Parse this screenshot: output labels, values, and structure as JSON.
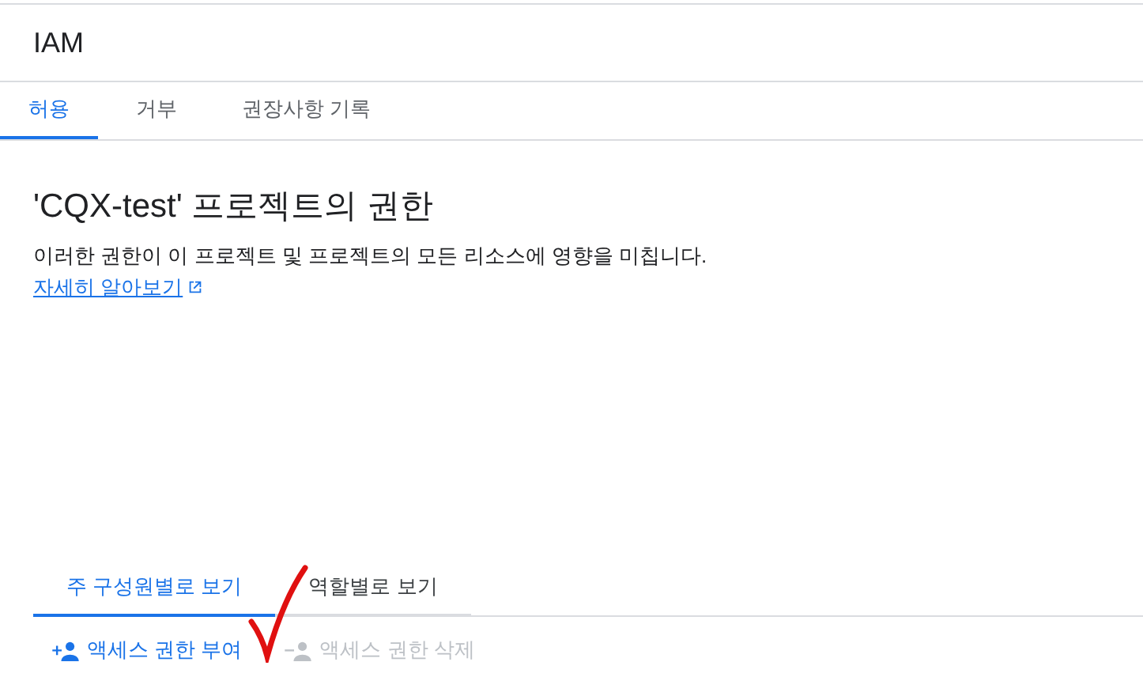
{
  "header": {
    "title": "IAM"
  },
  "tabs": [
    {
      "label": "허용",
      "selected": true
    },
    {
      "label": "거부",
      "selected": false
    },
    {
      "label": "권장사항 기록",
      "selected": false
    }
  ],
  "heading": "'CQX-test' 프로젝트의 권한",
  "description": {
    "text": "이러한 권한이 이 프로젝트 및 프로젝트의 모든 리소스에 영향을 미칩니다.",
    "link": "자세히 알아보기"
  },
  "view_tabs": [
    {
      "label": "주 구성원별로 보기",
      "selected": true
    },
    {
      "label": "역할별로 보기",
      "selected": false
    }
  ],
  "actions": [
    {
      "label": "액세스 권한 부여",
      "kind": "add",
      "disabled": false
    },
    {
      "label": "액세스 권한 삭제",
      "kind": "remove",
      "disabled": true
    }
  ],
  "annotation": {
    "kind": "checkmark"
  }
}
